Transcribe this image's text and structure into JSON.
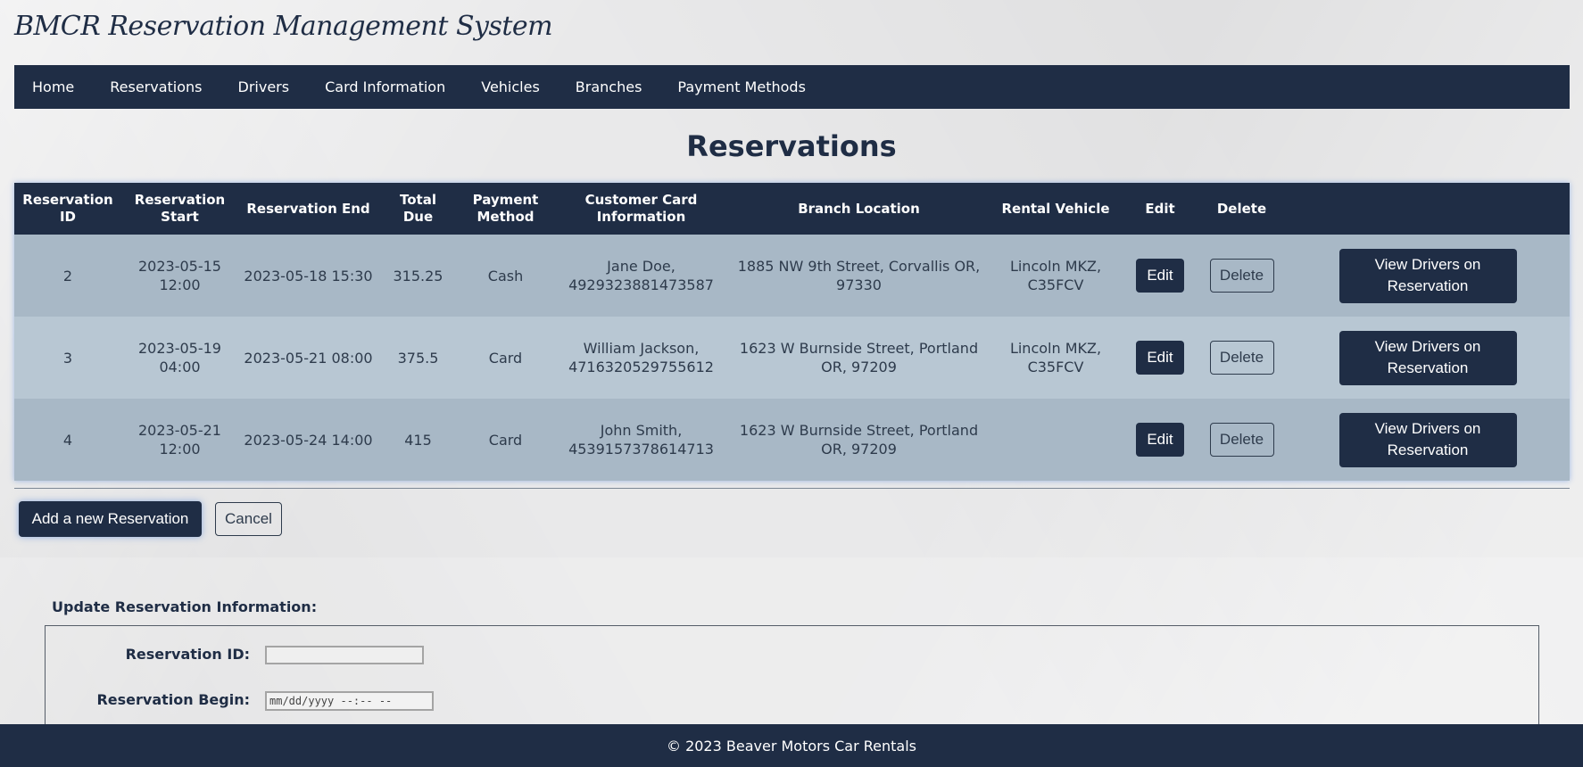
{
  "app": {
    "title": "BMCR Reservation Management System"
  },
  "nav": {
    "items": [
      {
        "label": "Home"
      },
      {
        "label": "Reservations"
      },
      {
        "label": "Drivers"
      },
      {
        "label": "Card Information"
      },
      {
        "label": "Vehicles"
      },
      {
        "label": "Branches"
      },
      {
        "label": "Payment Methods"
      }
    ]
  },
  "main": {
    "title": "Reservations",
    "table": {
      "headers": [
        "Reservation ID",
        "Reservation Start",
        "Reservation End",
        "Total Due",
        "Payment Method",
        "Customer Card Information",
        "Branch Location",
        "Rental Vehicle",
        "Edit",
        "Delete",
        ""
      ],
      "rows": [
        {
          "id": "2",
          "start": "2023-05-15 12:00",
          "end": "2023-05-18 15:30",
          "total": "315.25",
          "payment": "Cash",
          "card": "Jane Doe, 4929323881473587",
          "branch": "1885 NW 9th Street, Corvallis OR, 97330",
          "vehicle": "Lincoln MKZ, C35FCV"
        },
        {
          "id": "3",
          "start": "2023-05-19 04:00",
          "end": "2023-05-21 08:00",
          "total": "375.5",
          "payment": "Card",
          "card": "William Jackson, 4716320529755612",
          "branch": "1623 W Burnside Street, Portland OR, 97209",
          "vehicle": "Lincoln MKZ, C35FCV"
        },
        {
          "id": "4",
          "start": "2023-05-21 12:00",
          "end": "2023-05-24 14:00",
          "total": "415",
          "payment": "Card",
          "card": "John Smith, 4539157378614713",
          "branch": "1623 W Burnside Street, Portland OR, 97209",
          "vehicle": ""
        }
      ],
      "edit_label": "Edit",
      "delete_label": "Delete",
      "view_label": "View Drivers on Reservation"
    },
    "add_label": "Add a new Reservation",
    "cancel_label": "Cancel"
  },
  "update_form": {
    "heading": "Update Reservation Information:",
    "id_label": "Reservation ID:",
    "id_value": "",
    "begin_label": "Reservation Begin:",
    "begin_placeholder": "mm/dd/yyyy --:-- --"
  },
  "footer": {
    "text": "© 2023 Beaver Motors Car Rentals"
  },
  "colors": {
    "primary": "#1f2d45",
    "row_odd": "#a8b8c6",
    "row_even": "#b8c7d3"
  }
}
